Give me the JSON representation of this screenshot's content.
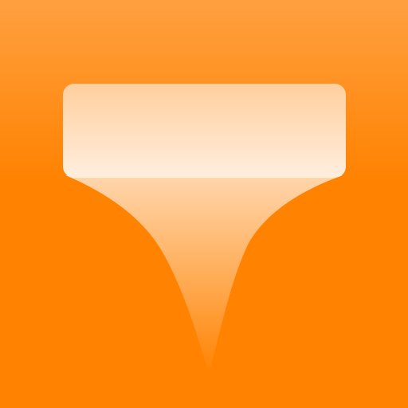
{
  "icon": {
    "semantic": "funnel-filter-icon",
    "colors": {
      "background_top": "#ffa040",
      "background_bottom": "#ff8200",
      "panel_top": "#ffcf9e",
      "panel_bottom": "#ffeede",
      "beam": "#fff2e6"
    }
  }
}
